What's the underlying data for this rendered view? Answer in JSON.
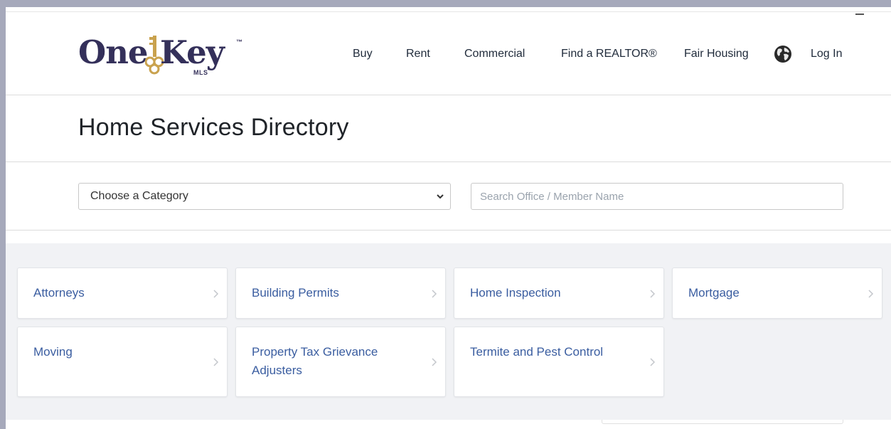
{
  "logo": {
    "word_one": "One",
    "word_key": "Key",
    "tm": "™",
    "mls": "MLS"
  },
  "nav": {
    "buy": "Buy",
    "rent": "Rent",
    "commercial": "Commercial",
    "find_realtor": "Find a REALTOR®",
    "fair_housing": "Fair Housing",
    "globe_icon": "globe-icon",
    "login": "Log In"
  },
  "page": {
    "title": "Home Services Directory"
  },
  "filters": {
    "category_selected": "Choose a Category",
    "search_placeholder": "Search Office / Member Name"
  },
  "categories": [
    "Attorneys",
    "Building Permits",
    "Home Inspection",
    "Mortgage",
    "Moving",
    "Property Tax Grievance Adjusters",
    "Termite and Pest Control"
  ],
  "colors": {
    "brand": "#34305a",
    "link": "#3a5da0",
    "key_gold": "#c9a24e",
    "grid_bg": "#f1f2f5"
  }
}
